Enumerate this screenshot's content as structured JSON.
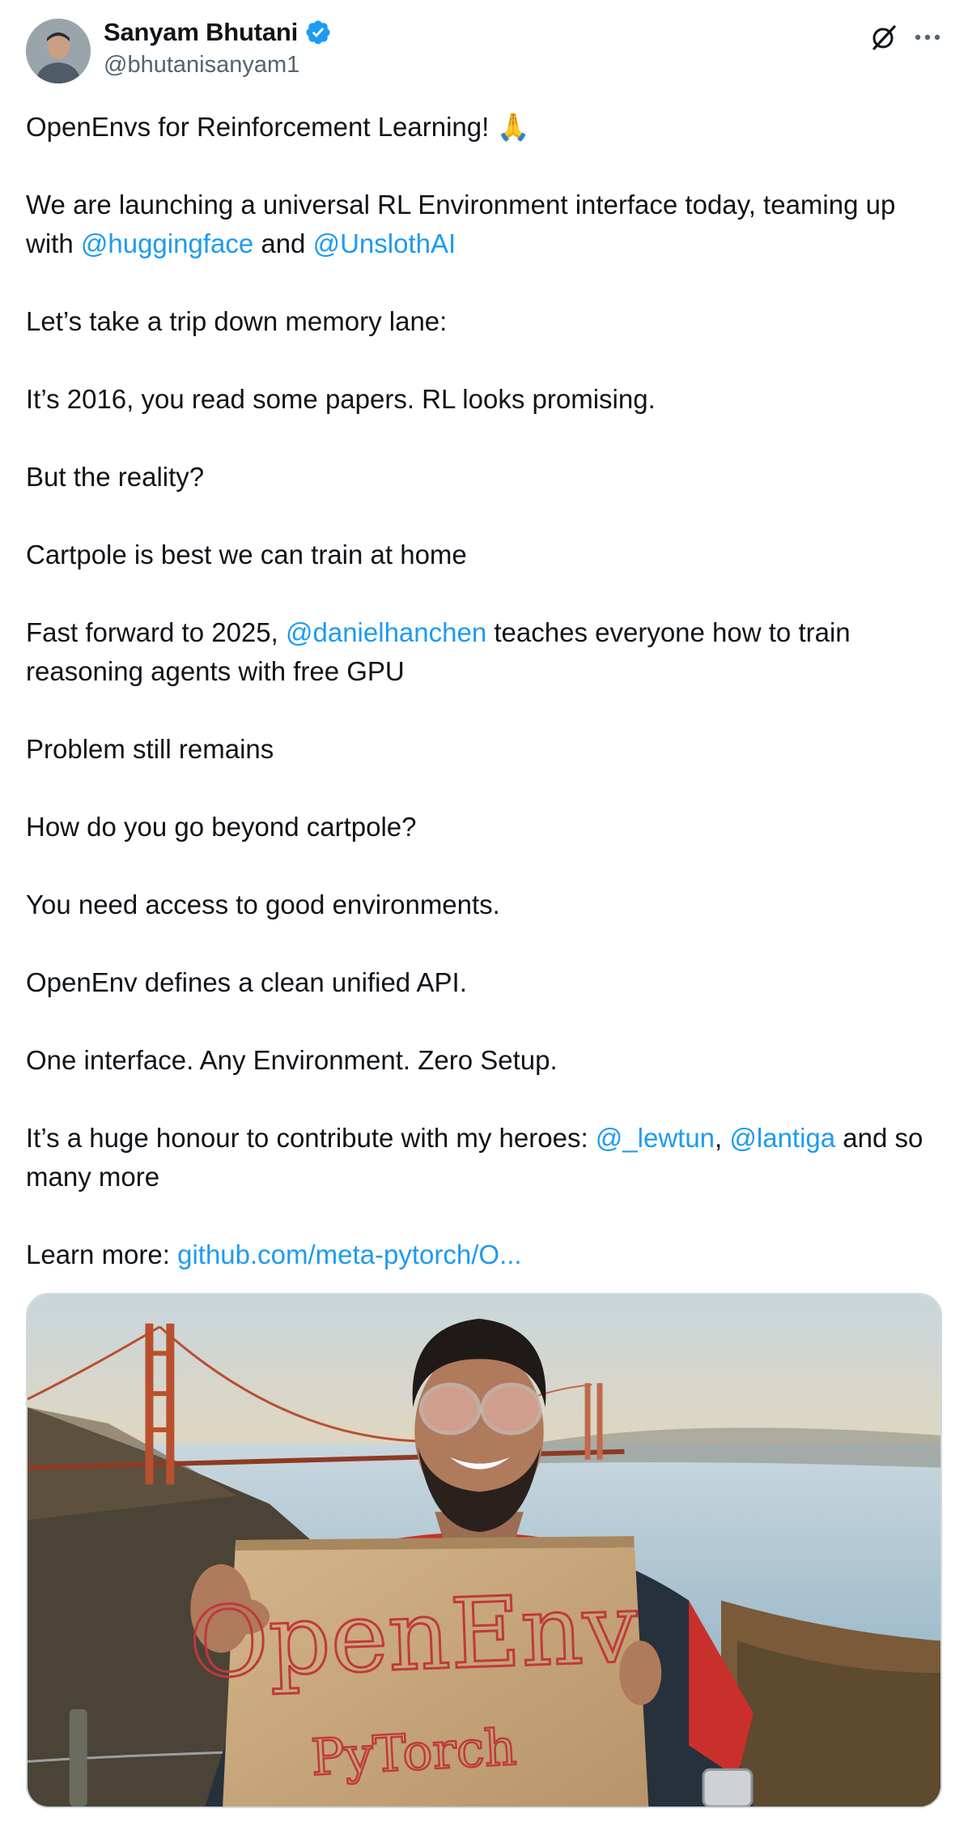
{
  "author": {
    "name": "Sanyam Bhutani",
    "handle": "@bhutanisanyam1",
    "verified": true,
    "avatar_icon": "user-avatar"
  },
  "actions": {
    "grok_icon": "grok-icon",
    "more_icon": "more-horizontal-icon"
  },
  "tweet": {
    "p1": {
      "text": "OpenEnvs for Reinforcement Learning! ",
      "emoji": "🙏"
    },
    "p2": {
      "pre": "We are launching a universal RL Environment interface today, teaming up with ",
      "m1": "@huggingface",
      "mid": " and ",
      "m2": "@UnslothAI"
    },
    "p3": "Let’s take a trip down memory lane:",
    "p4": "It’s 2016, you read some papers. RL looks promising.",
    "p5": "But the reality?",
    "p6": "Cartpole is best we can train at home",
    "p7": {
      "pre": "Fast forward to 2025, ",
      "m1": "@danielhanchen",
      "post": " teaches everyone how to train reasoning agents with free GPU"
    },
    "p8": "Problem still remains",
    "p9": "How do you go beyond cartpole?",
    "p10": "You need access to good environments.",
    "p11": "OpenEnv defines a clean unified API.",
    "p12": "One interface. Any Environment. Zero Setup.",
    "p13": {
      "pre": "It’s a huge honour to contribute with my heroes: ",
      "m1": "@_lewtun",
      "sep": ", ",
      "m2": "@lantiga",
      "post": " and so many more"
    },
    "p14": {
      "pre": "Learn more: ",
      "link": "github.com/meta-pytorch/O..."
    }
  },
  "media": {
    "sign_line1": "OpenEnv",
    "sign_line2": "PyTorch",
    "colors": {
      "sky_top": "#cfd8de",
      "sky_glow": "#f6c27a",
      "bridge": "#b8502f",
      "water": "#8fb3c8",
      "cardboard": "#c9a77c",
      "marker": "#c0393b"
    }
  },
  "colors": {
    "link": "#1d9bf0",
    "text": "#0f1419",
    "secondary": "#536471"
  }
}
